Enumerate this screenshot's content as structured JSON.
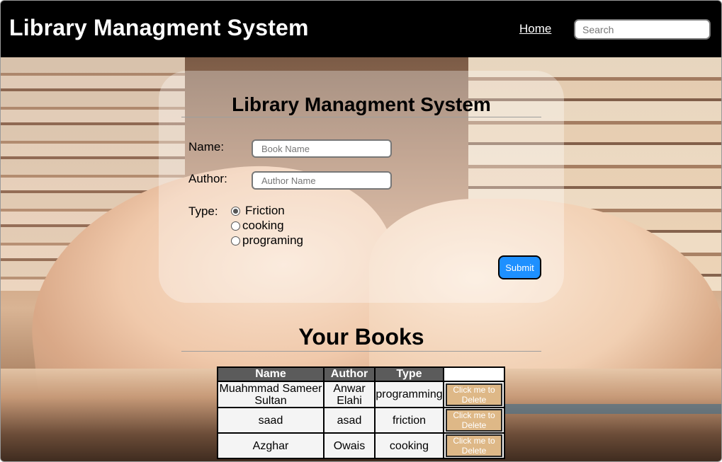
{
  "navbar": {
    "brand": "Library Managment System",
    "home_link": "Home",
    "search_placeholder": "Search"
  },
  "form": {
    "title": "Library Managment System",
    "name_label": "Name:",
    "name_placeholder": "Book Name",
    "author_label": "Author:",
    "author_placeholder": "Author Name",
    "type_label": "Type:",
    "types": [
      {
        "label": "Friction",
        "checked": true
      },
      {
        "label": "cooking",
        "checked": false
      },
      {
        "label": "programing",
        "checked": false
      }
    ],
    "submit_label": "Submit"
  },
  "books": {
    "title": "Your Books",
    "headers": [
      "Name",
      "Author",
      "Type",
      ""
    ],
    "delete_label": "Click me to Delete",
    "rows": [
      {
        "name": "Muahmmad Sameer Sultan",
        "author": "Anwar Elahi",
        "type": "programming"
      },
      {
        "name": "saad",
        "author": "asad",
        "type": "friction"
      },
      {
        "name": "Azghar",
        "author": "Owais",
        "type": "cooking"
      }
    ]
  },
  "colors": {
    "navbar_bg": "#000000",
    "submit_bg": "#1e90ff",
    "delete_bg": "#deb887",
    "table_header_bg": "#5b5b5b"
  }
}
